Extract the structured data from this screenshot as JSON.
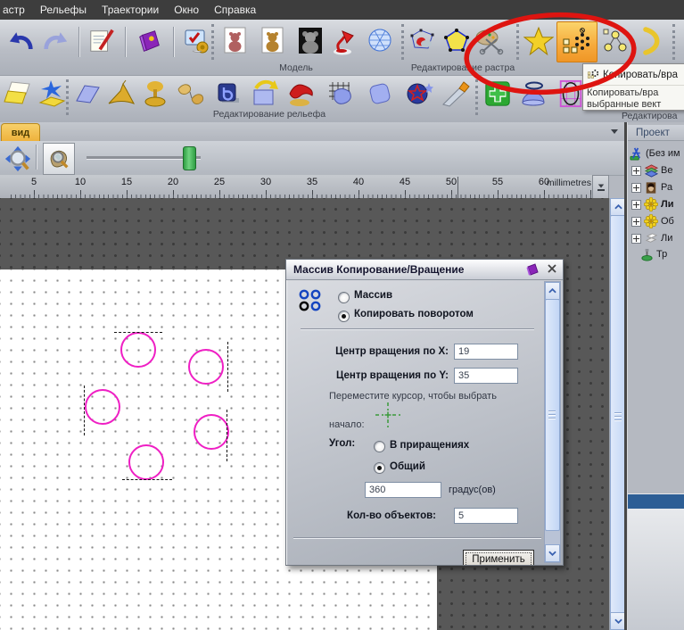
{
  "menubar": {
    "items": [
      "астр",
      "Рельефы",
      "Траектории",
      "Окно",
      "Справка"
    ]
  },
  "toolbar_row1": {
    "groups": [
      {
        "label": "",
        "icons": [
          "undo-icon",
          "redo-icon",
          "edit-notes-icon",
          "help-book-icon",
          "options-icon"
        ]
      },
      {
        "label": "Модель",
        "icons": [
          "model-new-icon",
          "model-open-icon",
          "model-photo-icon",
          "lamp-icon",
          "mesh-sphere-icon"
        ]
      },
      {
        "label": "Редактирование растра",
        "icons": [
          "vector-paint-icon",
          "polygon-nodes-icon",
          "palette-scissors-icon"
        ]
      },
      {
        "label": "",
        "icons": [
          "star-icon",
          "block-copy-rotate-icon",
          "paste-along-vector-icon",
          "arc-icon"
        ]
      }
    ]
  },
  "toolbar_row2": {
    "relief_label": "Редактирование рельефа",
    "right_label": "Редактирова",
    "icons_left": [
      "sheets-icon",
      "splash-icon"
    ],
    "icons_relief": [
      "plane-icon",
      "volcano-icon",
      "mushroom-icon",
      "hands-icon",
      "b-block-icon",
      "wrap-arrow-icon",
      "drape-icon",
      "pillow-wireframe-icon",
      "smooth-square-icon",
      "sphere-star-icon",
      "chisel-icon"
    ],
    "icons_right": [
      "add-relief-icon",
      "dome-halo-icon",
      "grid-oval-icon"
    ]
  },
  "tooltip": {
    "title": "Копировать/вра",
    "line1": "Копировать/вра",
    "line2": "выбранные вект"
  },
  "view": {
    "tab": "вид"
  },
  "ruler": {
    "ticks": [
      "5",
      "10",
      "15",
      "20",
      "25",
      "30",
      "35",
      "40",
      "45",
      "50",
      "55",
      "60"
    ],
    "units": "millimetres"
  },
  "dialog": {
    "title": "Массив Копирование/Вращение",
    "radio_array": "Массив",
    "radio_rotate": "Копировать поворотом",
    "center_x_label": "Центр вращения по X:",
    "center_x_value": "19",
    "center_y_label": "Центр вращения по Y:",
    "center_y_value": "35",
    "hint_line1": "Переместите курсор, чтобы выбрать",
    "hint_line2": "начало:",
    "angle_label": "Угол:",
    "radio_incremental": "В приращениях",
    "radio_total": "Общий",
    "angle_value": "360",
    "degrees_label": "градус(ов)",
    "count_label": "Кол-во объектов:",
    "count_value": "5",
    "apply_label": "Применить"
  },
  "project": {
    "title": "Проект",
    "items": [
      {
        "label": "(Без им"
      },
      {
        "label": "Ве"
      },
      {
        "label": "Ра"
      },
      {
        "label": "Ли"
      },
      {
        "label": "Об"
      },
      {
        "label": "Ли"
      },
      {
        "label": "Тр"
      }
    ]
  },
  "canvas": {
    "object_count": 5,
    "colors": {
      "vector": "#ef1fc4",
      "annotation": "#de1410",
      "highlight": "#f6a93b",
      "panel_bar": "#2d5e95"
    }
  }
}
